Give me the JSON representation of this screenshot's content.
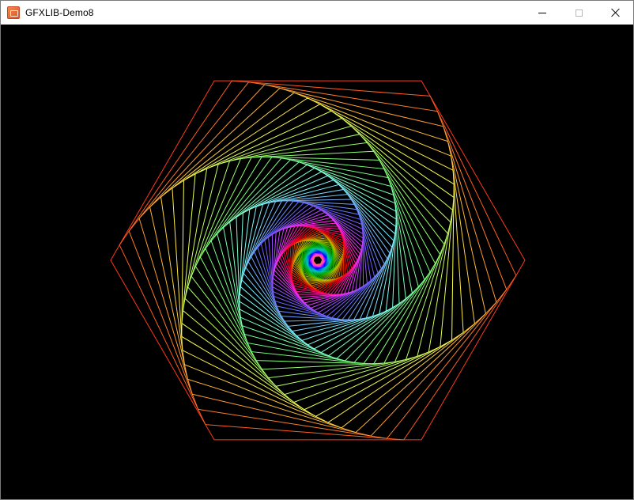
{
  "window": {
    "title": "GFXLIB-Demo8",
    "icon": "gfxlib-app-icon"
  },
  "controls": {
    "minimize": "minimize-icon",
    "maximize": "maximize-icon",
    "close": "close-icon"
  },
  "canvas": {
    "background": "#000000",
    "pattern": "rotating-hexagon-spiral",
    "colors": "rainbow-gradient"
  }
}
